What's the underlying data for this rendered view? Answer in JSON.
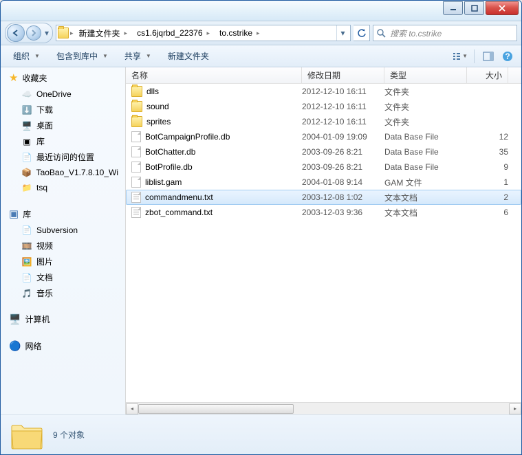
{
  "breadcrumb": [
    "新建文件夹",
    "cs1.6jqrbd_22376",
    "to.cstrike"
  ],
  "search_placeholder": "搜索 to.cstrike",
  "toolbar": {
    "organize": "组织",
    "include": "包含到库中",
    "share": "共享",
    "newfolder": "新建文件夹"
  },
  "sidebar": {
    "fav_hdr": "收藏夹",
    "fav": [
      {
        "icon": "onedrive",
        "label": "OneDrive"
      },
      {
        "icon": "download",
        "label": "下载"
      },
      {
        "icon": "desktop",
        "label": "桌面"
      },
      {
        "icon": "lib",
        "label": "库"
      },
      {
        "icon": "recent",
        "label": "最近访问的位置"
      },
      {
        "icon": "winrar",
        "label": "TaoBao_V1.7.8.10_Wi"
      },
      {
        "icon": "folder",
        "label": "tsq"
      }
    ],
    "lib_hdr": "库",
    "lib": [
      {
        "icon": "svn",
        "label": "Subversion"
      },
      {
        "icon": "vid",
        "label": "视频"
      },
      {
        "icon": "pic",
        "label": "图片"
      },
      {
        "icon": "doc",
        "label": "文档"
      },
      {
        "icon": "music",
        "label": "音乐"
      }
    ],
    "computer": "计算机",
    "network": "网络"
  },
  "columns": {
    "name": "名称",
    "date": "修改日期",
    "type": "类型",
    "size": "大小"
  },
  "files": [
    {
      "kind": "folder",
      "name": "dlls",
      "date": "2012-12-10 16:11",
      "type": "文件夹",
      "size": ""
    },
    {
      "kind": "folder",
      "name": "sound",
      "date": "2012-12-10 16:11",
      "type": "文件夹",
      "size": ""
    },
    {
      "kind": "folder",
      "name": "sprites",
      "date": "2012-12-10 16:11",
      "type": "文件夹",
      "size": ""
    },
    {
      "kind": "file",
      "name": "BotCampaignProfile.db",
      "date": "2004-01-09 19:09",
      "type": "Data Base File",
      "size": "12"
    },
    {
      "kind": "file",
      "name": "BotChatter.db",
      "date": "2003-09-26 8:21",
      "type": "Data Base File",
      "size": "35"
    },
    {
      "kind": "file",
      "name": "BotProfile.db",
      "date": "2003-09-26 8:21",
      "type": "Data Base File",
      "size": "9"
    },
    {
      "kind": "file",
      "name": "liblist.gam",
      "date": "2004-01-08 9:14",
      "type": "GAM 文件",
      "size": "1"
    },
    {
      "kind": "txt",
      "name": "commandmenu.txt",
      "date": "2003-12-08 1:02",
      "type": "文本文档",
      "size": "2",
      "selected": true
    },
    {
      "kind": "txt",
      "name": "zbot_command.txt",
      "date": "2003-12-03 9:36",
      "type": "文本文档",
      "size": "6"
    }
  ],
  "details": {
    "count": "9 个对象"
  }
}
